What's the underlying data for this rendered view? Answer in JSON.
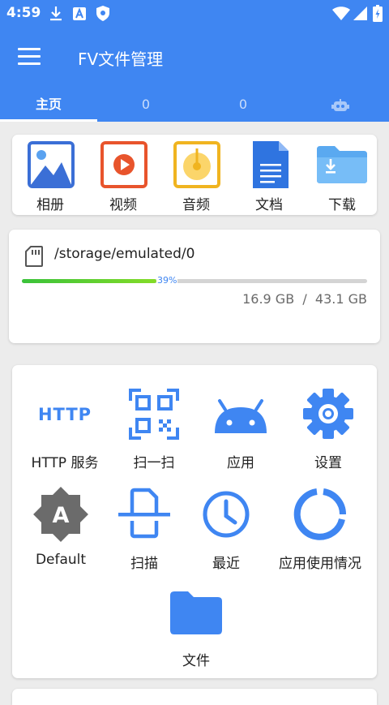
{
  "status_bar": {
    "time": "4:59",
    "icons": [
      "download-icon",
      "app-notification-icon",
      "shield-icon",
      "wifi-icon",
      "signal-icon",
      "battery-icon"
    ]
  },
  "app_bar": {
    "title": "FV文件管理",
    "menu_icon": "hamburger-menu-icon"
  },
  "tabs": [
    {
      "label": "主页",
      "active": true
    },
    {
      "label": "0",
      "active": false
    },
    {
      "label": "0",
      "active": false
    },
    {
      "label": "",
      "icon": "robot-icon",
      "active": false
    }
  ],
  "categories": [
    {
      "label": "相册",
      "icon": "photo-icon"
    },
    {
      "label": "视频",
      "icon": "video-icon"
    },
    {
      "label": "音频",
      "icon": "audio-icon"
    },
    {
      "label": "文档",
      "icon": "document-icon"
    },
    {
      "label": "下载",
      "icon": "download-folder-icon"
    }
  ],
  "storage": {
    "path": "/storage/emulated/0",
    "percent": 39,
    "percent_text": "39%",
    "used": "16.9 GB",
    "separator": "/",
    "total": "43.1 GB"
  },
  "tools": [
    {
      "label": "HTTP 服务",
      "icon": "http-icon",
      "icon_text": "HTTP"
    },
    {
      "label": "扫一扫",
      "icon": "qr-scan-icon"
    },
    {
      "label": "应用",
      "icon": "android-icon"
    },
    {
      "label": "设置",
      "icon": "gear-icon"
    },
    {
      "label": "Default",
      "icon": "theme-icon",
      "icon_text": "A"
    },
    {
      "label": "扫描",
      "icon": "document-scan-icon"
    },
    {
      "label": "最近",
      "icon": "clock-icon"
    },
    {
      "label": "应用使用情况",
      "icon": "usage-ring-icon"
    },
    {
      "label": "文件",
      "icon": "folder-icon"
    }
  ],
  "colors": {
    "primary": "#3f86f2",
    "photo": "#3b6fd6",
    "video": "#e8542c",
    "audio": "#f0b420",
    "document": "#2f74e0",
    "download": "#5aa9f0",
    "progress": "#52cc2c",
    "theme_icon": "#6b6b6b"
  }
}
